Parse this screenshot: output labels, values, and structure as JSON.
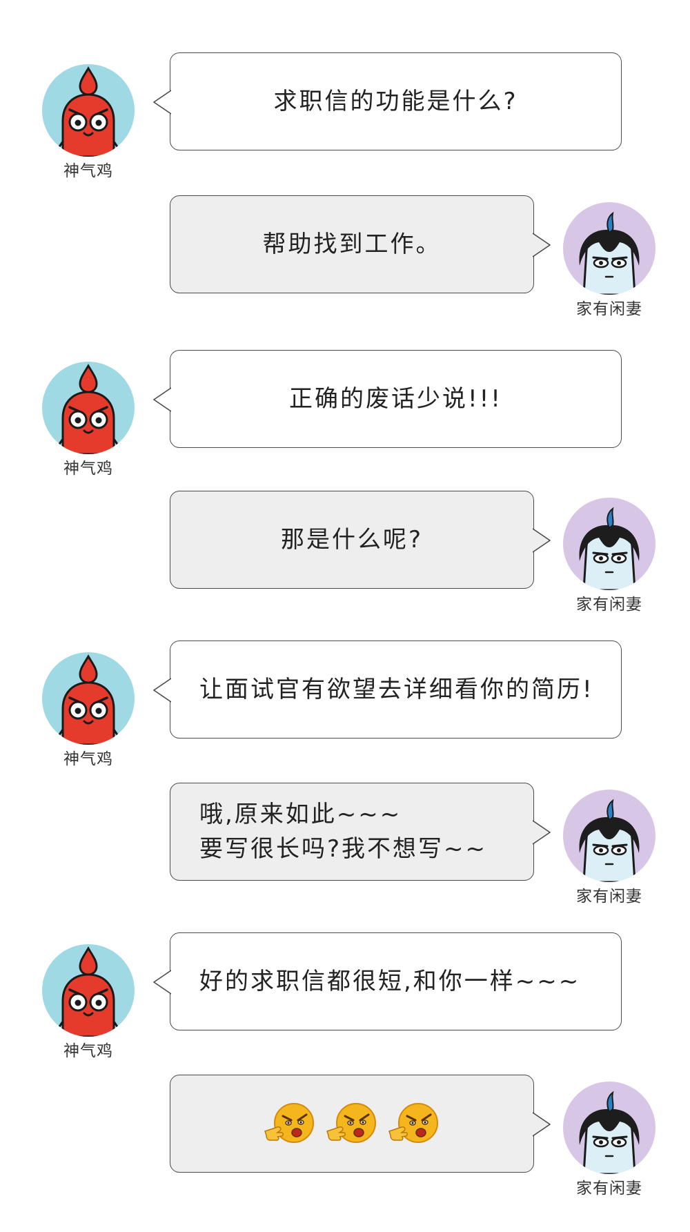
{
  "conversation": {
    "messages": [
      {
        "speaker": "神气鸡",
        "side": "left",
        "text": "求职信的功能是什么?"
      },
      {
        "speaker": "家有闲妻",
        "side": "right",
        "text": "帮助找到工作。"
      },
      {
        "speaker": "神气鸡",
        "side": "left",
        "text": "正确的废话少说!!!"
      },
      {
        "speaker": "家有闲妻",
        "side": "right",
        "text": "那是什么呢?"
      },
      {
        "speaker": "神气鸡",
        "side": "left",
        "text": "让面试官有欲望去详细看你的简历!"
      },
      {
        "speaker": "家有闲妻",
        "side": "right",
        "text": "哦,原来如此~~~\n要写很长吗?我不想写~~"
      },
      {
        "speaker": "神气鸡",
        "side": "left",
        "text": "好的求职信都很短,和你一样~~~"
      },
      {
        "speaker": "家有闲妻",
        "side": "right",
        "emoji": "angry-pointing-emoji",
        "emoji_count": 3
      }
    ]
  },
  "colors": {
    "rooster_avatar_bg": "#9fd9e3",
    "wife_avatar_bg": "#d8c6e6",
    "left_bubble_bg": "#ffffff",
    "right_bubble_bg": "#eeeeee",
    "bubble_border": "#4a4a4a"
  }
}
